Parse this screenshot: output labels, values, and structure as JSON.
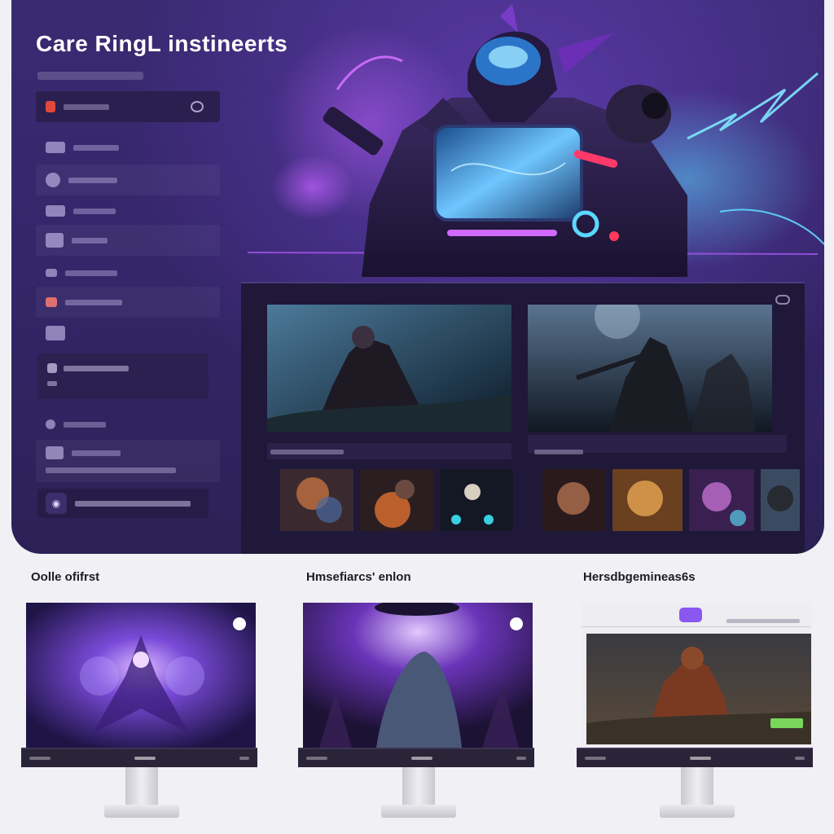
{
  "app": {
    "title": "Care RingL instineerts"
  },
  "sidebar": {
    "items": [
      {
        "name": "sidebar-item-1",
        "active": true
      },
      {
        "name": "sidebar-item-2"
      },
      {
        "name": "sidebar-item-3"
      },
      {
        "name": "sidebar-item-4"
      },
      {
        "name": "sidebar-item-5"
      },
      {
        "name": "sidebar-item-6"
      },
      {
        "name": "sidebar-item-7"
      },
      {
        "name": "sidebar-item-8"
      }
    ],
    "footer_icon": "controller-icon"
  },
  "showcase": {
    "sections": [
      {
        "label": "Oolle ofifrst"
      },
      {
        "label": "Hmsefiarcs' enlon"
      },
      {
        "label": "Hersdbgemineas6s"
      }
    ]
  },
  "colors": {
    "hero_bg": "#35266a",
    "accent_purple": "#8a58f0",
    "accent_cyan": "#38c8ff",
    "active_red": "#e0483e",
    "tag_green": "#7ad65a"
  }
}
